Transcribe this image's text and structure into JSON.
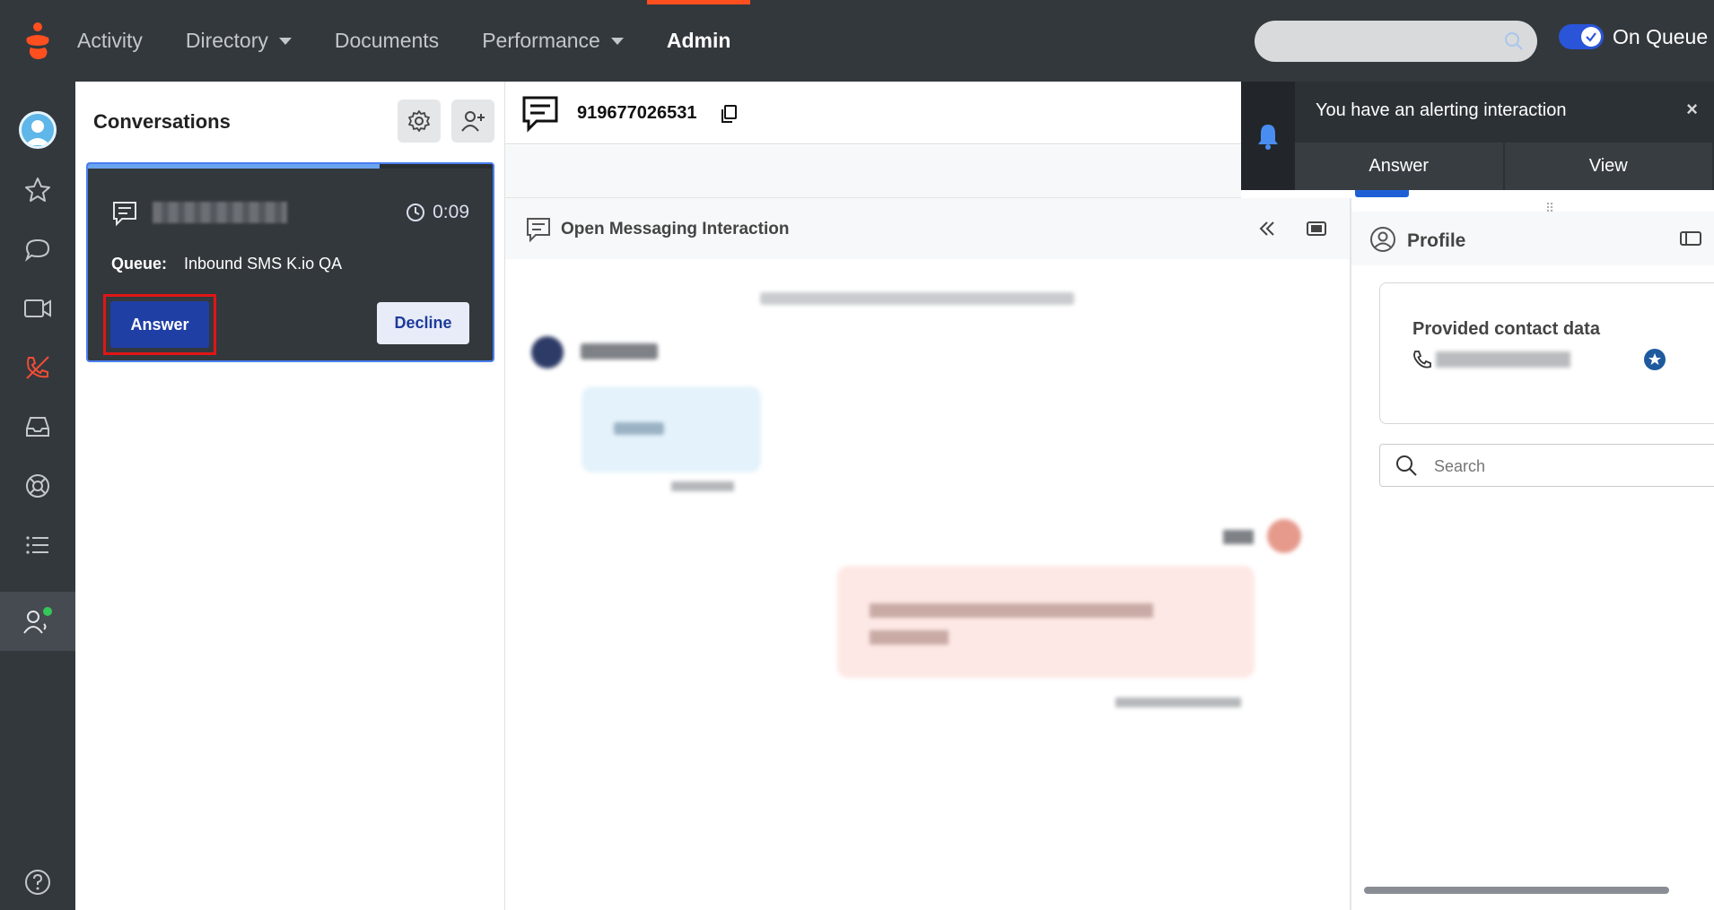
{
  "nav": {
    "items": [
      {
        "label": "Activity",
        "dropdown": false,
        "active": false
      },
      {
        "label": "Directory",
        "dropdown": true,
        "active": false
      },
      {
        "label": "Documents",
        "dropdown": false,
        "active": false
      },
      {
        "label": "Performance",
        "dropdown": true,
        "active": false
      },
      {
        "label": "Admin",
        "dropdown": false,
        "active": true
      }
    ],
    "on_queue_label": "On Queue",
    "on_queue_enabled": true
  },
  "colors": {
    "brand": "#ff4f1f",
    "topbar": "#33383d",
    "primary_button": "#1f3fa5",
    "highlight_border": "#e01616",
    "toggle": "#2a55d9"
  },
  "sidebar": {
    "icons": [
      "user-avatar-icon",
      "star-icon",
      "chat-icon",
      "video-icon",
      "phone-missed-icon",
      "inbox-icon",
      "lifebuoy-icon",
      "list-icon",
      "agent-status-icon",
      "help-icon"
    ]
  },
  "conversations": {
    "title": "Conversations",
    "card": {
      "elapsed": "0:09",
      "progress": 0.72,
      "queue_label": "Queue:",
      "queue_value": "Inbound SMS K.io QA",
      "answer_label": "Answer",
      "decline_label": "Decline"
    }
  },
  "interaction": {
    "phone": "919677026531"
  },
  "toast": {
    "message": "You have an alerting interaction",
    "close": "×",
    "answer_label": "Answer",
    "view_label": "View"
  },
  "messaging": {
    "title": "Open Messaging Interaction"
  },
  "profile": {
    "title": "Profile",
    "card_title": "Provided contact data",
    "search_placeholder": "Search"
  }
}
